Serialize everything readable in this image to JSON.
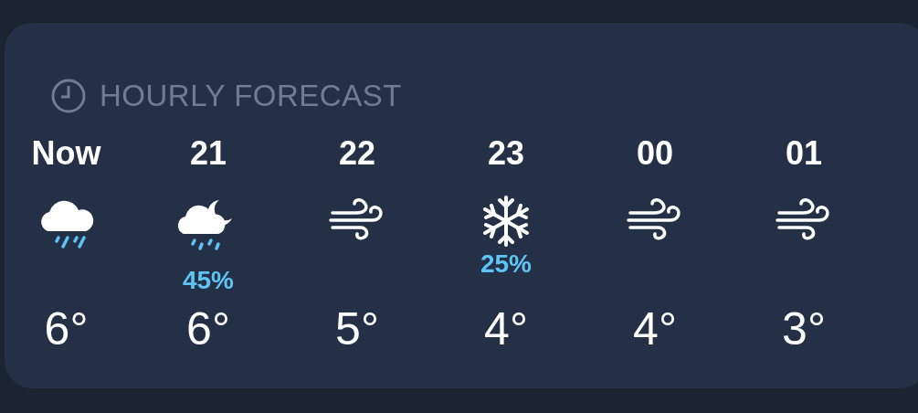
{
  "header": {
    "title": "HOURLY FORECAST"
  },
  "hours": [
    {
      "time": "Now",
      "kind": "rain",
      "temperature": "6°"
    },
    {
      "time": "21",
      "kind": "rain-night",
      "precipitation": "45%",
      "temperature": "6°"
    },
    {
      "time": "22",
      "kind": "wind",
      "temperature": "5°"
    },
    {
      "time": "23",
      "kind": "snow",
      "precipitation": "25%",
      "temperature": "4°"
    },
    {
      "time": "00",
      "kind": "wind",
      "temperature": "4°"
    },
    {
      "time": "01",
      "kind": "wind",
      "temperature": "3°"
    }
  ]
}
